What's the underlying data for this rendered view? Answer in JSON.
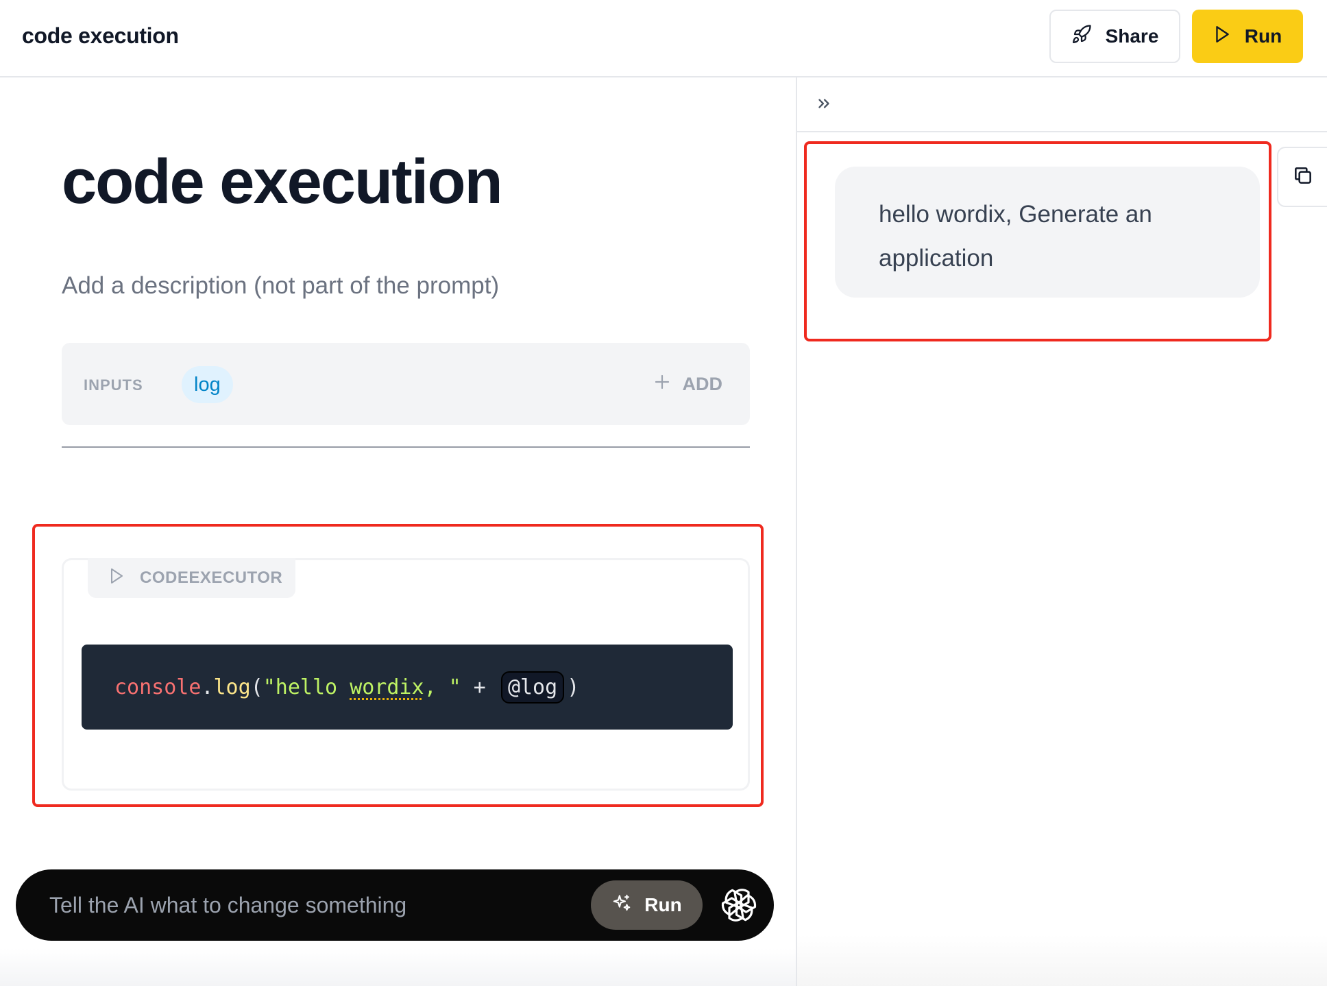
{
  "header": {
    "title": "code execution",
    "share_label": "Share",
    "run_label": "Run"
  },
  "doc": {
    "title": "code execution",
    "description": "Add a description (not part of the prompt)"
  },
  "inputs": {
    "label": "INPUTS",
    "chips": [
      "log"
    ],
    "add_label": "ADD"
  },
  "code_executor": {
    "label": "CODEEXECUTOR",
    "code_tokens": {
      "obj": "console",
      "dot": ".",
      "method": "log",
      "open": "(",
      "str1": "\"hello ",
      "str_word": "wordix",
      "str2": ", \"",
      "plus": " + ",
      "var": "@log",
      "close": ")"
    }
  },
  "ai_bar": {
    "placeholder": "Tell the AI what to change something",
    "run_label": "Run"
  },
  "output": {
    "text": "hello wordix, Generate an application"
  },
  "icons": {
    "share": "rocket-icon",
    "run": "play-icon",
    "executor": "play-outline-icon",
    "add": "plus-icon",
    "ai_run": "sparkles-icon",
    "ai_logo": "openai-logo-icon",
    "collapse": "chevrons-right-icon",
    "copy": "copy-icon"
  },
  "colors": {
    "accent": "#facc15",
    "annotation": "#ef2a1f",
    "code_bg": "#1f2937",
    "chip_bg": "#e0f2fe",
    "chip_text": "#0284c7"
  }
}
